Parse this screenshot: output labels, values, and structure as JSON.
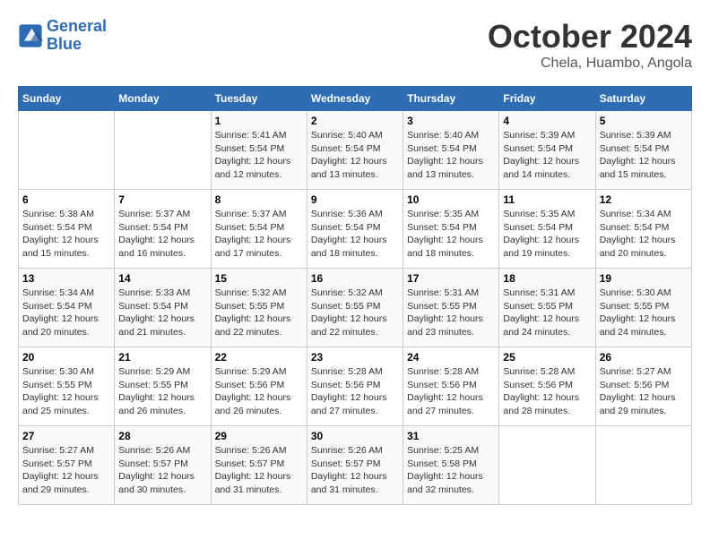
{
  "header": {
    "logo_line1": "General",
    "logo_line2": "Blue",
    "month": "October 2024",
    "location": "Chela, Huambo, Angola"
  },
  "weekdays": [
    "Sunday",
    "Monday",
    "Tuesday",
    "Wednesday",
    "Thursday",
    "Friday",
    "Saturday"
  ],
  "weeks": [
    [
      {
        "day": "",
        "info": ""
      },
      {
        "day": "",
        "info": ""
      },
      {
        "day": "1",
        "info": "Sunrise: 5:41 AM\nSunset: 5:54 PM\nDaylight: 12 hours and 12 minutes."
      },
      {
        "day": "2",
        "info": "Sunrise: 5:40 AM\nSunset: 5:54 PM\nDaylight: 12 hours and 13 minutes."
      },
      {
        "day": "3",
        "info": "Sunrise: 5:40 AM\nSunset: 5:54 PM\nDaylight: 12 hours and 13 minutes."
      },
      {
        "day": "4",
        "info": "Sunrise: 5:39 AM\nSunset: 5:54 PM\nDaylight: 12 hours and 14 minutes."
      },
      {
        "day": "5",
        "info": "Sunrise: 5:39 AM\nSunset: 5:54 PM\nDaylight: 12 hours and 15 minutes."
      }
    ],
    [
      {
        "day": "6",
        "info": "Sunrise: 5:38 AM\nSunset: 5:54 PM\nDaylight: 12 hours and 15 minutes."
      },
      {
        "day": "7",
        "info": "Sunrise: 5:37 AM\nSunset: 5:54 PM\nDaylight: 12 hours and 16 minutes."
      },
      {
        "day": "8",
        "info": "Sunrise: 5:37 AM\nSunset: 5:54 PM\nDaylight: 12 hours and 17 minutes."
      },
      {
        "day": "9",
        "info": "Sunrise: 5:36 AM\nSunset: 5:54 PM\nDaylight: 12 hours and 18 minutes."
      },
      {
        "day": "10",
        "info": "Sunrise: 5:35 AM\nSunset: 5:54 PM\nDaylight: 12 hours and 18 minutes."
      },
      {
        "day": "11",
        "info": "Sunrise: 5:35 AM\nSunset: 5:54 PM\nDaylight: 12 hours and 19 minutes."
      },
      {
        "day": "12",
        "info": "Sunrise: 5:34 AM\nSunset: 5:54 PM\nDaylight: 12 hours and 20 minutes."
      }
    ],
    [
      {
        "day": "13",
        "info": "Sunrise: 5:34 AM\nSunset: 5:54 PM\nDaylight: 12 hours and 20 minutes."
      },
      {
        "day": "14",
        "info": "Sunrise: 5:33 AM\nSunset: 5:54 PM\nDaylight: 12 hours and 21 minutes."
      },
      {
        "day": "15",
        "info": "Sunrise: 5:32 AM\nSunset: 5:55 PM\nDaylight: 12 hours and 22 minutes."
      },
      {
        "day": "16",
        "info": "Sunrise: 5:32 AM\nSunset: 5:55 PM\nDaylight: 12 hours and 22 minutes."
      },
      {
        "day": "17",
        "info": "Sunrise: 5:31 AM\nSunset: 5:55 PM\nDaylight: 12 hours and 23 minutes."
      },
      {
        "day": "18",
        "info": "Sunrise: 5:31 AM\nSunset: 5:55 PM\nDaylight: 12 hours and 24 minutes."
      },
      {
        "day": "19",
        "info": "Sunrise: 5:30 AM\nSunset: 5:55 PM\nDaylight: 12 hours and 24 minutes."
      }
    ],
    [
      {
        "day": "20",
        "info": "Sunrise: 5:30 AM\nSunset: 5:55 PM\nDaylight: 12 hours and 25 minutes."
      },
      {
        "day": "21",
        "info": "Sunrise: 5:29 AM\nSunset: 5:55 PM\nDaylight: 12 hours and 26 minutes."
      },
      {
        "day": "22",
        "info": "Sunrise: 5:29 AM\nSunset: 5:56 PM\nDaylight: 12 hours and 26 minutes."
      },
      {
        "day": "23",
        "info": "Sunrise: 5:28 AM\nSunset: 5:56 PM\nDaylight: 12 hours and 27 minutes."
      },
      {
        "day": "24",
        "info": "Sunrise: 5:28 AM\nSunset: 5:56 PM\nDaylight: 12 hours and 27 minutes."
      },
      {
        "day": "25",
        "info": "Sunrise: 5:28 AM\nSunset: 5:56 PM\nDaylight: 12 hours and 28 minutes."
      },
      {
        "day": "26",
        "info": "Sunrise: 5:27 AM\nSunset: 5:56 PM\nDaylight: 12 hours and 29 minutes."
      }
    ],
    [
      {
        "day": "27",
        "info": "Sunrise: 5:27 AM\nSunset: 5:57 PM\nDaylight: 12 hours and 29 minutes."
      },
      {
        "day": "28",
        "info": "Sunrise: 5:26 AM\nSunset: 5:57 PM\nDaylight: 12 hours and 30 minutes."
      },
      {
        "day": "29",
        "info": "Sunrise: 5:26 AM\nSunset: 5:57 PM\nDaylight: 12 hours and 31 minutes."
      },
      {
        "day": "30",
        "info": "Sunrise: 5:26 AM\nSunset: 5:57 PM\nDaylight: 12 hours and 31 minutes."
      },
      {
        "day": "31",
        "info": "Sunrise: 5:25 AM\nSunset: 5:58 PM\nDaylight: 12 hours and 32 minutes."
      },
      {
        "day": "",
        "info": ""
      },
      {
        "day": "",
        "info": ""
      }
    ]
  ]
}
